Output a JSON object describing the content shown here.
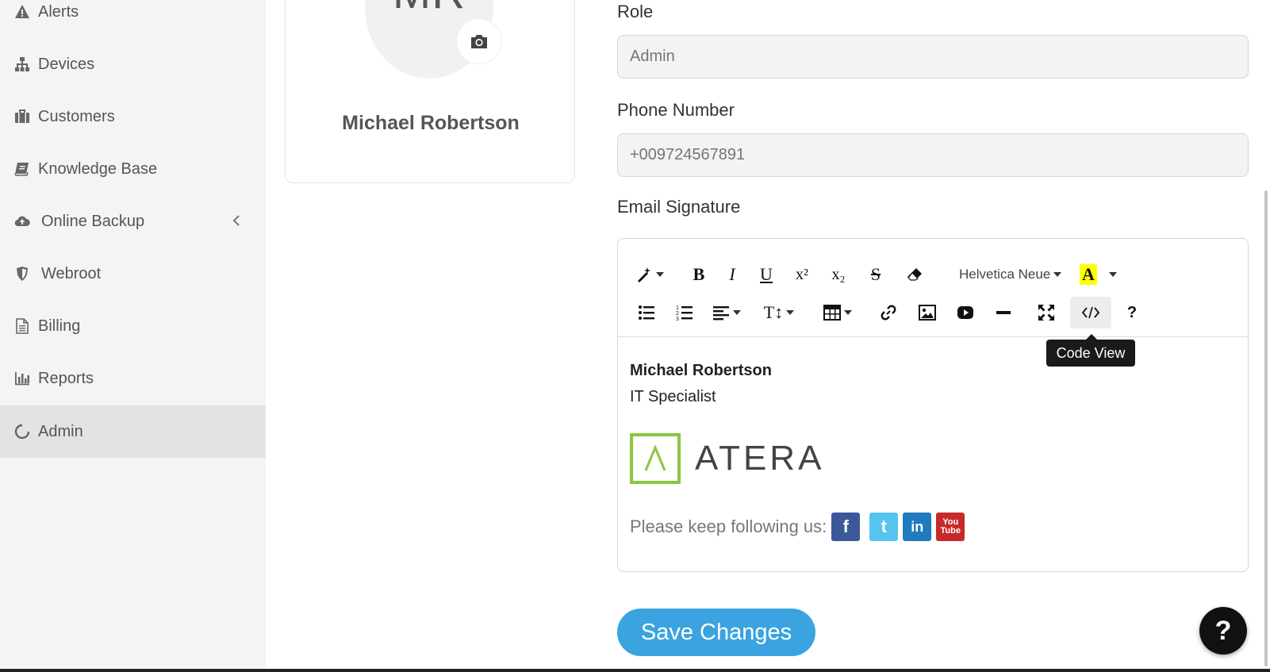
{
  "sidebar": {
    "items": [
      {
        "label": "Alerts",
        "icon": "warning-icon"
      },
      {
        "label": "Devices",
        "icon": "sitemap-icon"
      },
      {
        "label": "Customers",
        "icon": "briefcase-icon"
      },
      {
        "label": "Knowledge Base",
        "icon": "book-icon"
      },
      {
        "label": "Online Backup",
        "icon": "cloud-upload-icon"
      },
      {
        "label": "Webroot",
        "icon": "shield-icon"
      },
      {
        "label": "Billing",
        "icon": "document-icon"
      },
      {
        "label": "Reports",
        "icon": "bar-chart-icon"
      },
      {
        "label": "Admin",
        "icon": "spinner-icon"
      }
    ],
    "active": "Admin"
  },
  "profile": {
    "initials": "MR",
    "name": "Michael Robertson"
  },
  "form": {
    "role_label": "Role",
    "role_placeholder": "Admin",
    "phone_label": "Phone Number",
    "phone_placeholder": "+009724567891",
    "signature_label": "Email Signature"
  },
  "editor": {
    "font_name": "Helvetica Neue",
    "tooltip": "Code View",
    "signature": {
      "name": "Michael Robertson",
      "title": "IT Specialist",
      "logo_text": "ATERA",
      "follow_text": "Please keep following us:"
    }
  },
  "actions": {
    "save_label": "Save Changes",
    "help_label": "?"
  },
  "colors": {
    "sidebar_bg": "#f4f4f4",
    "active_bg": "#e3e3e3",
    "primary": "#3ba3df",
    "logo_green": "#8cc63f"
  }
}
